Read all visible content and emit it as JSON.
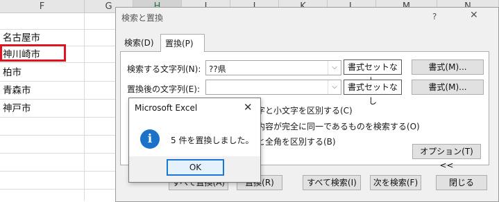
{
  "sheet": {
    "columns": [
      "F",
      "G",
      "H",
      "I",
      "J",
      "K",
      "L",
      "M",
      "N"
    ],
    "cells": [
      "名古屋市",
      "神川崎市",
      "柏市",
      "青森市",
      "神戸市"
    ]
  },
  "dialog": {
    "title": "検索と置換",
    "help": "?",
    "close": "✕",
    "tabs": {
      "search": "検索(D)",
      "replace": "置換(P)"
    },
    "find_label": "検索する文字列(N):",
    "find_value": "??県",
    "replace_label": "置換後の文字列(E):",
    "replace_value": "",
    "no_format_label": "書式セットなし",
    "format_button": "書式(M)...",
    "options": {
      "case": "字と小文字を区別する(C)",
      "whole": "内容が完全に同一であるものを検索する(O)",
      "width": "と全角を区別する(B)"
    },
    "options_button": "オプション(T) <<",
    "buttons": {
      "replace_all": "すべて置換(A)",
      "replace": "置換(R)",
      "find_all": "すべて検索(I)",
      "find_next": "次を検索(F)",
      "close": "閉じる"
    }
  },
  "message_box": {
    "title": "Microsoft Excel",
    "close": "✕",
    "icon": "info-icon",
    "icon_glyph": "i",
    "text": "5 件を置換しました。",
    "ok": "OK"
  }
}
